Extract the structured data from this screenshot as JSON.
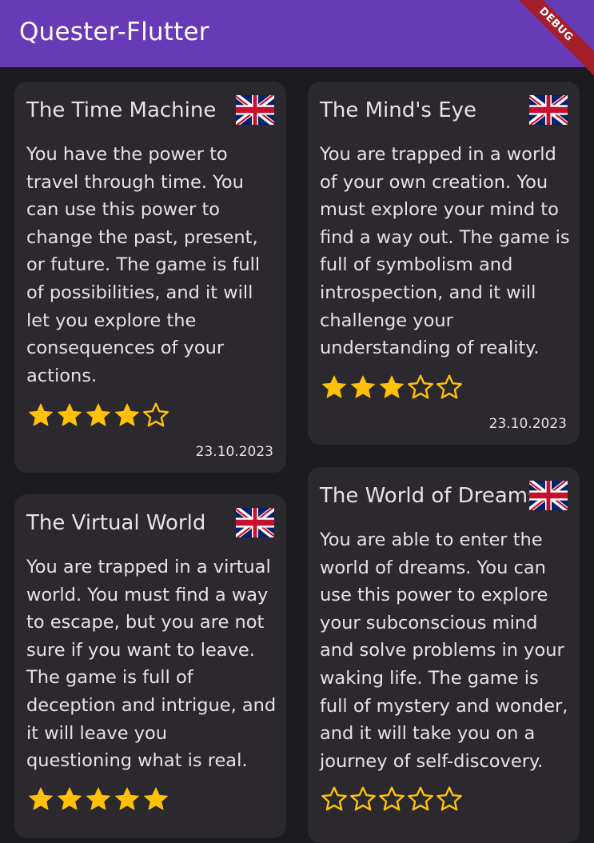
{
  "app": {
    "title": "Quester-Flutter",
    "debug_label": "DEBUG"
  },
  "colors": {
    "appbar": "#673ab7",
    "background": "#1c1b1f",
    "card": "#2b292e",
    "star": "#ffc107"
  },
  "cards": [
    {
      "title": "The Time Machine",
      "flag_icon": "uk-flag-icon",
      "description": "You have the power to travel through time. You can use this power to change the past, present, or future. The game is full of possibilities, and it will let you explore the consequences of your actions.",
      "rating": 4,
      "max_rating": 5,
      "date": "23.10.2023"
    },
    {
      "title": "The Mind's Eye",
      "flag_icon": "uk-flag-icon",
      "description": "You are trapped in a world of your own creation. You must explore your mind to find a way out. The game is full of symbolism and introspection, and it will challenge your understanding of reality.",
      "rating": 3,
      "max_rating": 5,
      "date": "23.10.2023"
    },
    {
      "title": "The Virtual World",
      "flag_icon": "uk-flag-icon",
      "description": "You are trapped in a virtual world. You must find a way to escape, but you are not sure if you want to leave. The game is full of deception and intrigue, and it will leave you questioning what is real.",
      "rating": 5,
      "max_rating": 5
    },
    {
      "title": "The World of Dreams",
      "flag_icon": "uk-flag-icon",
      "description": "You are able to enter the world of dreams. You can use this power to explore your subconscious mind and solve problems in your waking life. The game is full of mystery and wonder, and it will take you on a journey of self-discovery.",
      "rating": 0,
      "max_rating": 5
    }
  ]
}
